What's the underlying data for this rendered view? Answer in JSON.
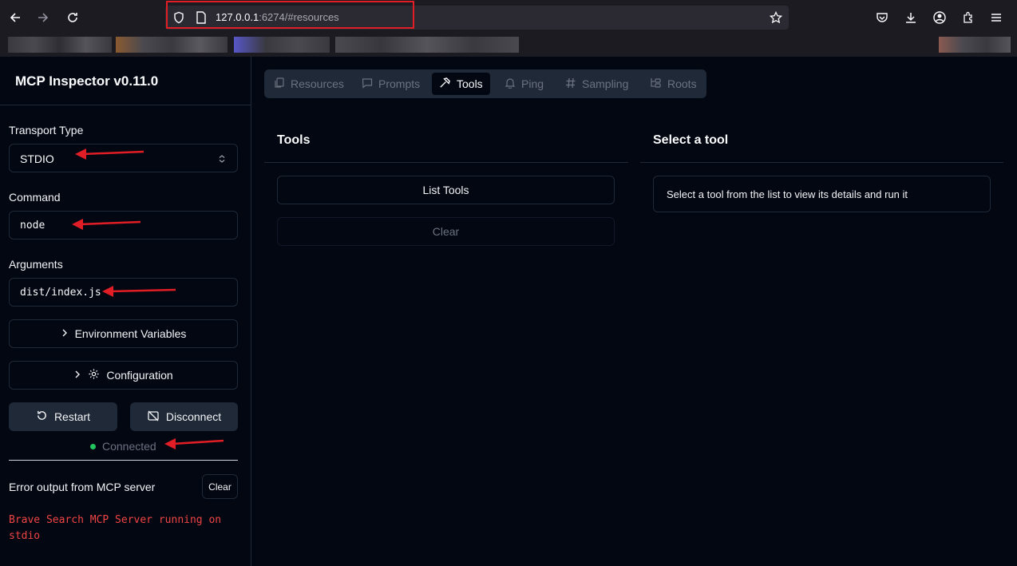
{
  "browser": {
    "url_host": "127.0.0.1",
    "url_rest": ":6274/#resources",
    "icons": [
      "back-arrow-icon",
      "forward-arrow-icon",
      "reload-icon",
      "shield-icon",
      "page-icon",
      "star-icon",
      "pocket-icon",
      "download-icon",
      "account-icon",
      "extensions-icon",
      "menu-icon"
    ]
  },
  "sidebar": {
    "title": "MCP Inspector v0.11.0",
    "transport_label": "Transport Type",
    "transport_value": "STDIO",
    "command_label": "Command",
    "command_value": "node",
    "arguments_label": "Arguments",
    "arguments_value": "dist/index.js",
    "env_button": "Environment Variables",
    "config_button": "Configuration",
    "restart_button": "Restart",
    "disconnect_button": "Disconnect",
    "status": "Connected",
    "error_title": "Error output from MCP server",
    "error_clear": "Clear",
    "error_log": "Brave Search MCP Server running on stdio"
  },
  "tabs": [
    {
      "label": "Resources",
      "icon": "files-icon",
      "active": false
    },
    {
      "label": "Prompts",
      "icon": "message-icon",
      "active": false
    },
    {
      "label": "Tools",
      "icon": "hammer-icon",
      "active": true
    },
    {
      "label": "Ping",
      "icon": "bell-icon",
      "active": false
    },
    {
      "label": "Sampling",
      "icon": "hash-icon",
      "active": false
    },
    {
      "label": "Roots",
      "icon": "folder-tree-icon",
      "active": false
    }
  ],
  "tools_panel": {
    "title": "Tools",
    "list_button": "List Tools",
    "clear_button": "Clear"
  },
  "detail_panel": {
    "title": "Select a tool",
    "hint": "Select a tool from the list to view its details and run it"
  },
  "colors": {
    "background": "#030712",
    "border": "#1f2937",
    "status_green": "#22c55e",
    "error_red": "#ef4444",
    "annotation_red": "#e11d25"
  }
}
